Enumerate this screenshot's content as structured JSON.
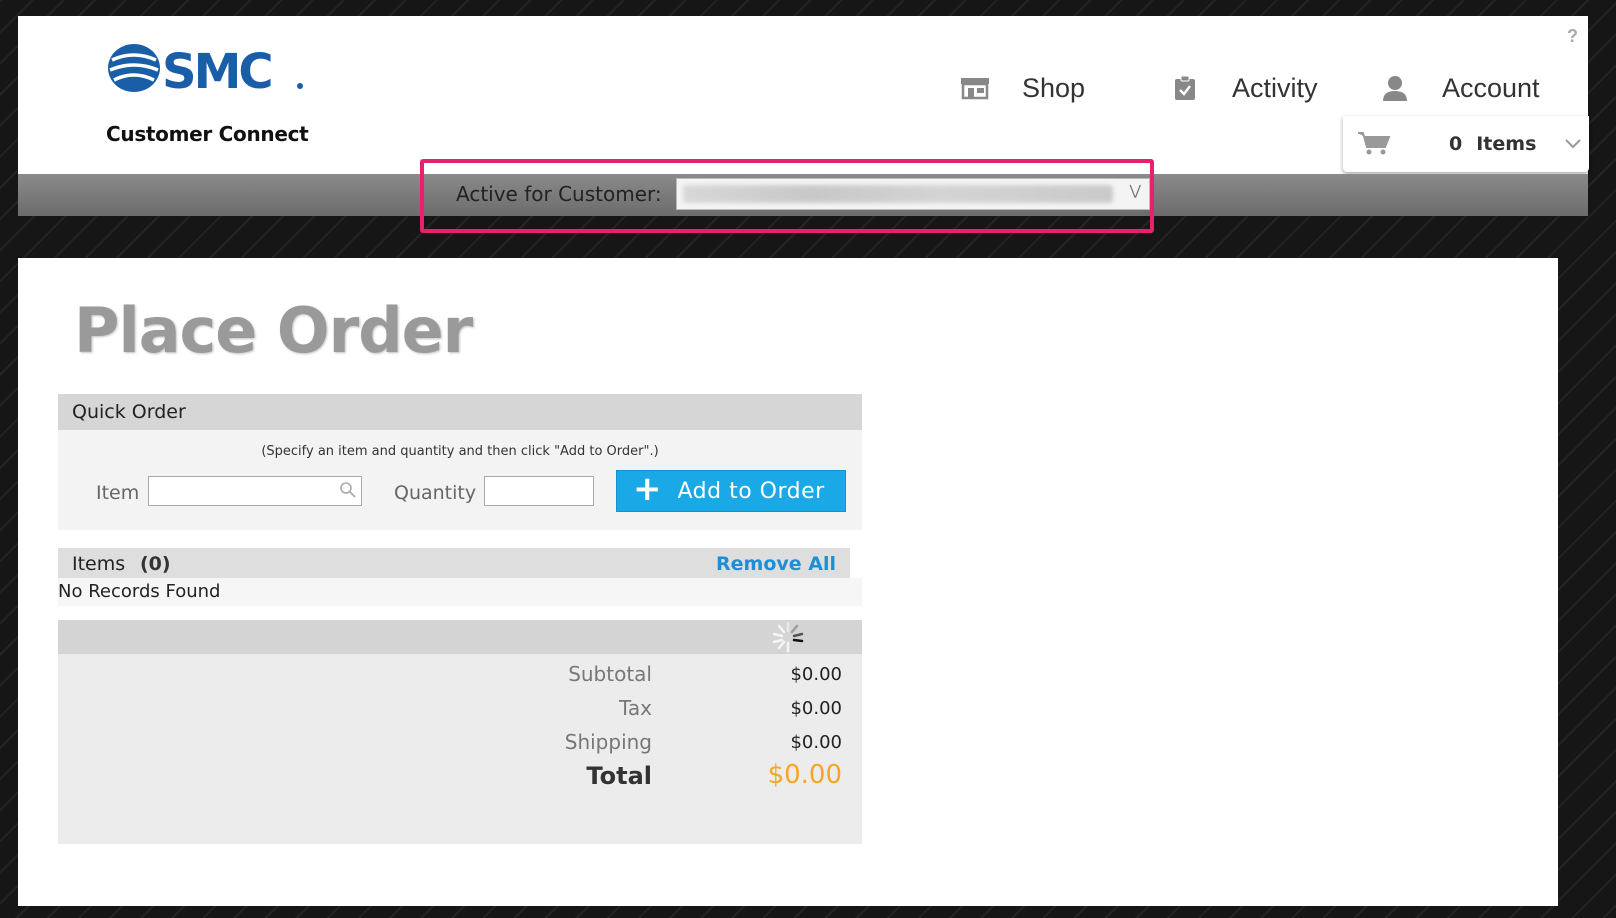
{
  "brand": {
    "logo_text": "SMC",
    "subtitle": "Customer Connect"
  },
  "help": {
    "label": "?"
  },
  "nav": {
    "shop": {
      "label": "Shop",
      "icon": "store-icon"
    },
    "activity": {
      "label": "Activity",
      "icon": "clipboard-icon"
    },
    "account": {
      "label": "Account",
      "icon": "user-icon"
    }
  },
  "cart": {
    "count": "0",
    "items_label": "Items",
    "icon": "cart-icon"
  },
  "customer_bar": {
    "label": "Active for Customer:",
    "selected_value_redacted": true
  },
  "page": {
    "title": "Place Order"
  },
  "quick_order": {
    "header": "Quick Order",
    "hint": "(Specify an item and quantity and then click \"Add to Order\".)",
    "item_label": "Item",
    "item_value": "",
    "quantity_label": "Quantity",
    "quantity_value": "",
    "add_button": "Add to Order"
  },
  "items": {
    "header": "Items",
    "count": "(0)",
    "remove_all": "Remove All",
    "empty_message": "No Records Found"
  },
  "totals": {
    "subtotal_label": "Subtotal",
    "subtotal_value": "$0.00",
    "tax_label": "Tax",
    "tax_value": "$0.00",
    "shipping_label": "Shipping",
    "shipping_value": "$0.00",
    "total_label": "Total",
    "total_value": "$0.00"
  },
  "colors": {
    "accent_blue": "#1aa8e6",
    "link_blue": "#1c8fd6",
    "total_orange": "#f5a623",
    "highlight_pink": "#e8206e",
    "brand_blue": "#1a5ea8"
  }
}
